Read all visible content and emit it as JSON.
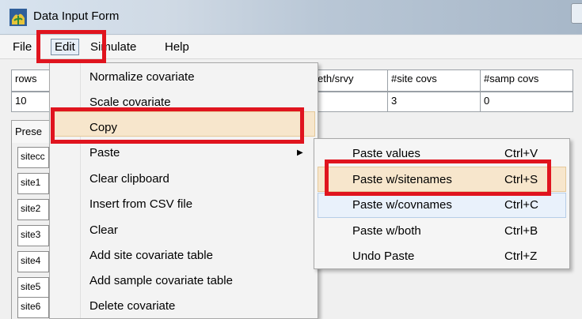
{
  "window": {
    "title": "Data Input Form"
  },
  "menubar": {
    "file": "File",
    "edit": "Edit",
    "simulate": "Simulate",
    "help": "Help"
  },
  "form": {
    "headers": {
      "rows": "rows",
      "depth": "eth/srvy",
      "site_covs": "#site covs",
      "samp_covs": "#samp covs"
    },
    "values": {
      "rows": "10",
      "site_covs": "3",
      "samp_covs": "0"
    },
    "tab_label": "Prese",
    "row_labels": [
      "sitecc",
      "site1",
      "site2",
      "site3",
      "site4",
      "site5",
      "site6"
    ]
  },
  "edit_menu": {
    "items": [
      "Normalize covariate",
      "Scale covariate",
      "Copy",
      "Paste",
      "Clear clipboard",
      "Insert from CSV file",
      "Clear",
      "Add site covariate table",
      "Add sample covariate table",
      "Delete covariate"
    ]
  },
  "paste_menu": {
    "items": [
      {
        "label": "Paste values",
        "shortcut": "Ctrl+V"
      },
      {
        "label": "Paste w/sitenames",
        "shortcut": "Ctrl+S"
      },
      {
        "label": "Paste w/covnames",
        "shortcut": "Ctrl+C"
      },
      {
        "label": "Paste w/both",
        "shortcut": "Ctrl+B"
      },
      {
        "label": "Undo Paste",
        "shortcut": "Ctrl+Z"
      }
    ]
  },
  "colors": {
    "annotation_red": "#e0141e",
    "highlight": "#f7e6cc",
    "hover": "#e9f1fb"
  },
  "icons": {
    "app": "plant-icon",
    "submenu": "arrow-right-icon"
  }
}
